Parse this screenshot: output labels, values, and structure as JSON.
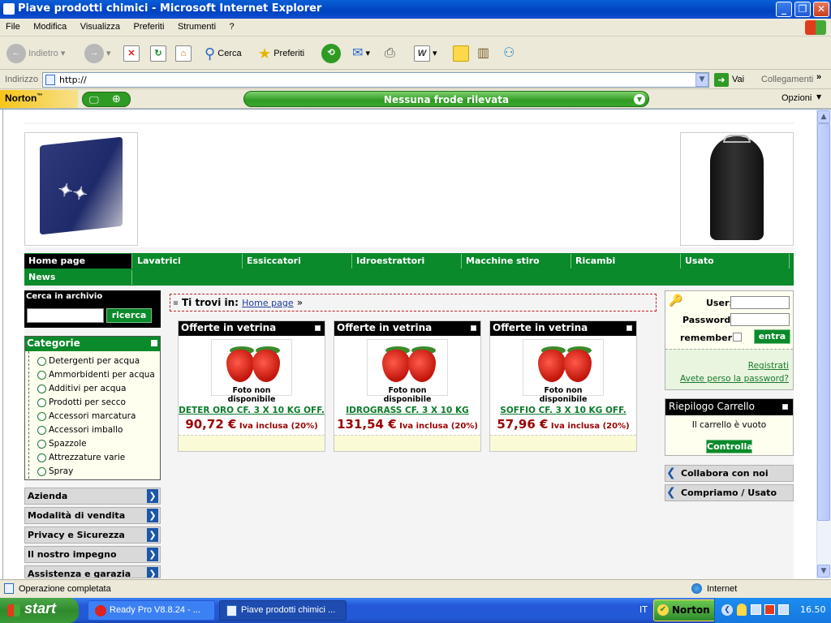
{
  "window": {
    "title": "Piave prodotti chimici - Microsoft Internet Explorer"
  },
  "menu": [
    "File",
    "Modifica",
    "Visualizza",
    "Preferiti",
    "Strumenti",
    "?"
  ],
  "toolbar": {
    "back": "Indietro",
    "search": "Cerca",
    "favorites": "Preferiti"
  },
  "address": {
    "label": "Indirizzo",
    "value": "http://",
    "go": "Vai",
    "links": "Collegamenti"
  },
  "norton": {
    "logo": "Norton",
    "status": "Nessuna frode rilevata",
    "options": "Opzioni"
  },
  "nav": {
    "row1": [
      "Home page",
      "Lavatrici",
      "Essiccatori",
      "Idroestrattori",
      "Macchine stiro",
      "Ricambi",
      "Usato"
    ],
    "row2": [
      "News"
    ]
  },
  "search": {
    "title": "Cerca in archivio",
    "button": "ricerca"
  },
  "categories": {
    "title": "Categorie",
    "items": [
      "Detergenti per acqua",
      "Ammorbidenti per acqua",
      "Additivi per acqua",
      "Prodotti per secco",
      "Accessori marcatura",
      "Accessori imballo",
      "Spazzole",
      "Attrezzature varie",
      "Spray"
    ]
  },
  "left_menu": [
    "Azienda",
    "Modalità di vendita",
    "Privacy e Sicurezza",
    "Il nostro impegno",
    "Assistenza e garazia"
  ],
  "breadcrumb": {
    "prefix": "Ti trovi in:",
    "link": "Home page",
    "sep": "»"
  },
  "vetrina": [
    {
      "head": "Offerte in vetrina",
      "photo": "Foto non disponibile",
      "name": "DETER ORO CF. 3 X 10 KG OFF.",
      "price": "90,72 €",
      "vat": "Iva inclusa (20%)"
    },
    {
      "head": "Offerte in vetrina",
      "photo": "Foto non disponibile",
      "name": "IDROGRASS CF. 3 X 10 KG",
      "price": "131,54 €",
      "vat": "Iva inclusa (20%)"
    },
    {
      "head": "Offerte in vetrina",
      "photo": "Foto non disponibile",
      "name": "SOFFIO CF. 3 X 10 KG OFF.",
      "price": "57,96 €",
      "vat": "Iva inclusa (20%)"
    }
  ],
  "login": {
    "user": "User:",
    "password": "Password:",
    "remember": "remember",
    "submit": "entra",
    "register": "Registrati",
    "forgot": "Avete perso la password?"
  },
  "cart": {
    "title": "Riepilogo Carrello",
    "empty": "Il carrello è vuoto",
    "check": "Controlla"
  },
  "right_links": [
    "Collabora con noi",
    "Compriamo / Usato"
  ],
  "status": {
    "text": "Operazione completata",
    "zone": "Internet"
  },
  "taskbar": {
    "start": "start",
    "tasks": [
      "Ready Pro V8.8.24 - ...",
      "Piave prodotti chimici ..."
    ],
    "lang": "IT",
    "norton": "Norton",
    "clock": "16.50"
  },
  "colors": {
    "nav_green": "#0a8a2a",
    "price_red": "#9b0000",
    "xp_blue": "#0042c0"
  }
}
